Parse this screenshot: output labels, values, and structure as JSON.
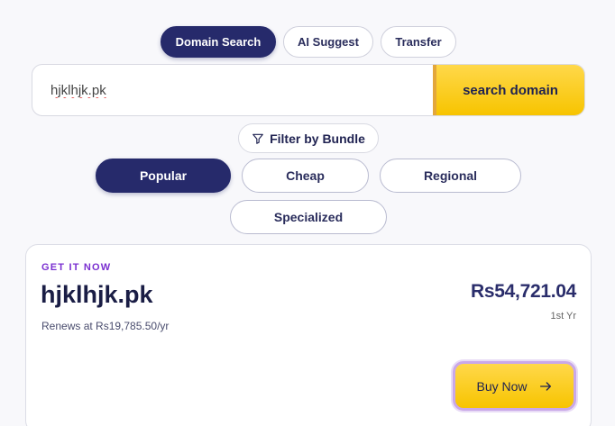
{
  "tabs": {
    "domain_search": "Domain Search",
    "ai_suggest": "AI Suggest",
    "transfer": "Transfer"
  },
  "search": {
    "value": "hjklhjk.pk",
    "button_label": "search domain"
  },
  "filter": {
    "label": "Filter by Bundle",
    "icon": "filter-icon"
  },
  "bundles": {
    "popular": "Popular",
    "cheap": "Cheap",
    "regional": "Regional",
    "specialized": "Specialized"
  },
  "result": {
    "eyebrow": "GET IT NOW",
    "domain": "hjklhjk.pk",
    "renews": "Renews at Rs19,785.50/yr",
    "price": "Rs54,721.04",
    "period": "1st Yr",
    "buy_label": "Buy Now",
    "buy_icon": "arrow-right-icon"
  },
  "colors": {
    "primary": "#262a6b",
    "accent": "#f7c400",
    "eyebrow": "#7a2fd0"
  }
}
